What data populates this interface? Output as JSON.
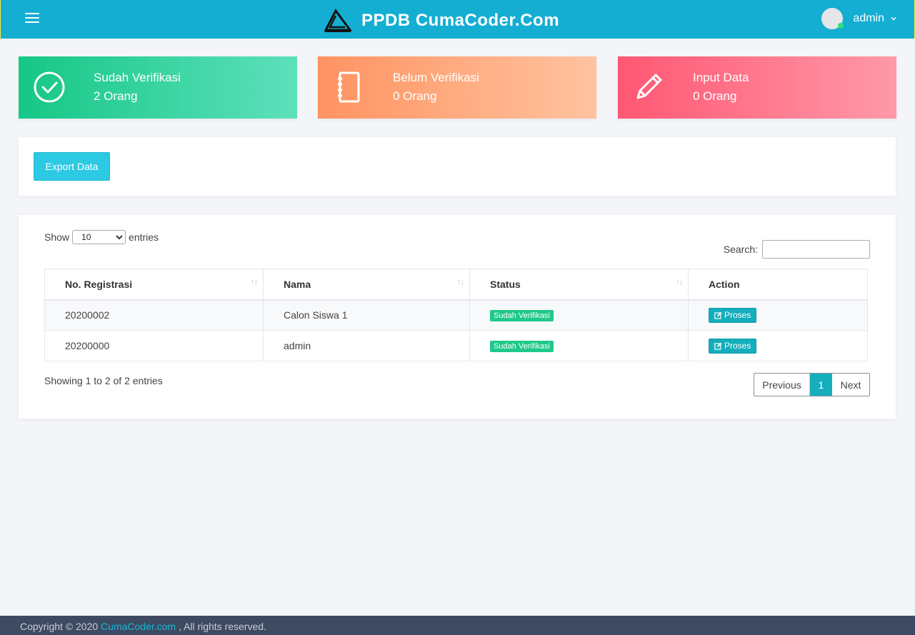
{
  "header": {
    "brand_title": "PPDB CumaCoder.Com",
    "user_name": "admin"
  },
  "stats": [
    {
      "title": "Sudah Verifikasi",
      "value": "2 Orang",
      "icon": "check-circle-icon"
    },
    {
      "title": "Belum Verifikasi",
      "value": "0 Orang",
      "icon": "notebook-icon"
    },
    {
      "title": "Input Data",
      "value": "0 Orang",
      "icon": "pencil-icon"
    }
  ],
  "toolbar": {
    "export_label": "Export Data"
  },
  "table": {
    "show_label": "Show",
    "entries_label": "entries",
    "length_value": "10",
    "search_label": "Search:",
    "search_value": "",
    "columns": [
      "No. Registrasi",
      "Nama",
      "Status",
      "Action"
    ],
    "rows": [
      {
        "no": "20200002",
        "nama": "Calon Siswa 1",
        "status": "Sudah Verifikasi",
        "action": "Proses"
      },
      {
        "no": "20200000",
        "nama": "admin",
        "status": "Sudah Verifikasi",
        "action": "Proses"
      }
    ],
    "info": "Showing 1 to 2 of 2 entries",
    "pagination": {
      "previous": "Previous",
      "current": "1",
      "next": "Next"
    }
  },
  "footer": {
    "prefix": "Copyright © 2020 ",
    "link": "CumaCoder.com",
    "suffix": " , All rights reserved."
  },
  "colors": {
    "topbar": "#14aed3",
    "green": "#16c786",
    "orange": "#ff9361",
    "red": "#ff5773",
    "accent": "#14aebc",
    "footer": "#3e4a62"
  }
}
